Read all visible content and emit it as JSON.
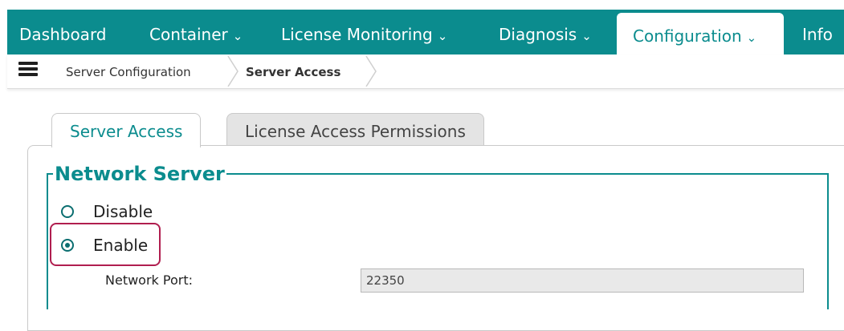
{
  "nav": {
    "items": [
      {
        "label": "Dashboard",
        "chevron": ""
      },
      {
        "label": "Container",
        "chevron": "⌄"
      },
      {
        "label": "License Monitoring",
        "chevron": "⌄"
      },
      {
        "label": "Diagnosis",
        "chevron": "⌄"
      },
      {
        "label": "Configuration",
        "chevron": "⌄"
      },
      {
        "label": "Info",
        "chevron": ""
      }
    ],
    "active_index": 4
  },
  "breadcrumb": {
    "items": [
      "Server Configuration",
      "Server Access"
    ]
  },
  "tabs": [
    {
      "label": "Server Access",
      "active": true
    },
    {
      "label": "License Access Permissions",
      "active": false
    }
  ],
  "network_server": {
    "legend": "Network Server",
    "options": [
      {
        "label": "Disable",
        "checked": false
      },
      {
        "label": "Enable",
        "checked": true
      }
    ],
    "port_label": "Network Port:",
    "port_value": "22350"
  },
  "colors": {
    "accent": "#0b8c8e",
    "highlight": "#b01e4f"
  },
  "icons": {
    "menu": "server-menu-icon"
  }
}
